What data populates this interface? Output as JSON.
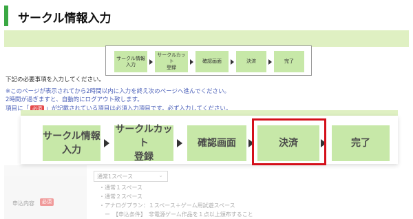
{
  "header": {
    "title": "サークル情報入力"
  },
  "small_steps": [
    {
      "label": "サークル情報\n入力"
    },
    {
      "label": "サークルカット\n登録"
    },
    {
      "label": "確認画面"
    },
    {
      "label": "決済"
    },
    {
      "label": "完了"
    }
  ],
  "body_text": {
    "line1": "下記の必要事項を入力してください。",
    "line2": "※このページが表示されてから2時間以内に入力を終え次のページへ進んでください。",
    "line3": "2時間が過ぎますと、自動的にログアウト致します。",
    "line4_pre": "項目に「",
    "required_badge": "必須",
    "line4_post": "」が記載されている項目は必須入力項目です。必ず入力してください。"
  },
  "zoom_steps": [
    {
      "label": "サークル情報\n入力"
    },
    {
      "label": "サークルカット\n登録"
    },
    {
      "label": "確認画面"
    },
    {
      "label": "決済"
    },
    {
      "label": "完了"
    }
  ],
  "form": {
    "row_label": "申込内容",
    "required_badge": "必須",
    "select_value": "通常1スペース",
    "options": [
      "・通常１スペース",
      "・通常２スペース",
      "・アナログプラン：１スペース＋ゲーム用試遊スペース",
      "　ー　【申込条件】　非電源ゲーム作品を１点以上頒布すること"
    ]
  },
  "colors": {
    "accent": "#3aa843",
    "band": "#dff0c2",
    "step": "#c7e8a8",
    "highlight": "#d40f1a",
    "link_text": "#4a5fb8"
  }
}
